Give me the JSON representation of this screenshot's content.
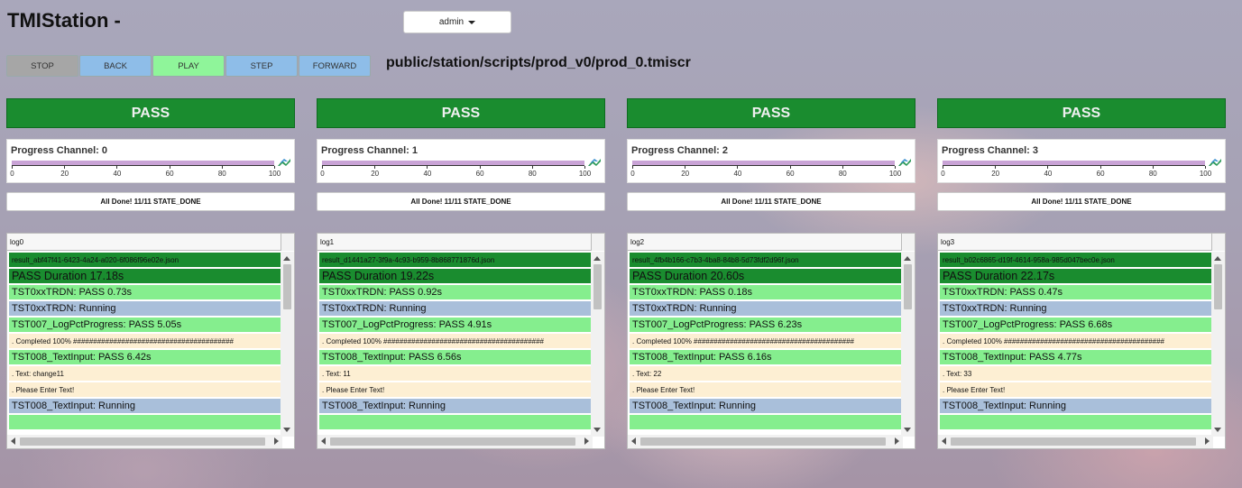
{
  "app": {
    "title": "TMIStation -"
  },
  "user_menu": {
    "label": "admin"
  },
  "controls": [
    {
      "label": "STOP",
      "color": "#a6a6a6"
    },
    {
      "label": "BACK",
      "color": "#8ebde8"
    },
    {
      "label": "PLAY",
      "color": "#8ff59a"
    },
    {
      "label": "STEP",
      "color": "#8ebde8"
    },
    {
      "label": "FORWARD",
      "color": "#8ebde8"
    }
  ],
  "script_path": "public/station/scripts/prod_v0/prod_0.tmiscr",
  "progress_ticks": [
    "0",
    "20",
    "40",
    "60",
    "80",
    "100"
  ],
  "channels": [
    {
      "status": "PASS",
      "progress_label": "Progress Channel: 0",
      "progress_percent": 100,
      "state_text": "All Done! 11/11 STATE_DONE",
      "log_title": "log0",
      "log_lines": [
        {
          "type": "file",
          "text": "result_abf47f41-6423-4a24-a020-6f086f96e02e.json"
        },
        {
          "type": "duration",
          "text": "PASS Duration 17.18s"
        },
        {
          "type": "pass",
          "text": "TST0xxTRDN: PASS 0.73s"
        },
        {
          "type": "running",
          "text": "TST0xxTRDN: Running"
        },
        {
          "type": "pass",
          "text": "TST007_LogPctProgress: PASS 5.05s"
        },
        {
          "type": "info",
          "text": ". Completed 100% ########################################"
        },
        {
          "type": "pass",
          "text": "TST008_TextInput: PASS 6.42s"
        },
        {
          "type": "info",
          "text": ". Text: change11"
        },
        {
          "type": "info",
          "text": ". Please Enter Text!"
        },
        {
          "type": "running",
          "text": "TST008_TextInput: Running"
        },
        {
          "type": "pass",
          "text": ""
        }
      ]
    },
    {
      "status": "PASS",
      "progress_label": "Progress Channel: 1",
      "progress_percent": 100,
      "state_text": "All Done! 11/11 STATE_DONE",
      "log_title": "log1",
      "log_lines": [
        {
          "type": "file",
          "text": "result_d1441a27-3f9a-4c93-b959-8b868771876d.json"
        },
        {
          "type": "duration",
          "text": "PASS Duration 19.22s"
        },
        {
          "type": "pass",
          "text": "TST0xxTRDN: PASS 0.92s"
        },
        {
          "type": "running",
          "text": "TST0xxTRDN: Running"
        },
        {
          "type": "pass",
          "text": "TST007_LogPctProgress: PASS 4.91s"
        },
        {
          "type": "info",
          "text": ". Completed 100% ########################################"
        },
        {
          "type": "pass",
          "text": "TST008_TextInput: PASS 6.56s"
        },
        {
          "type": "info",
          "text": ". Text: 11"
        },
        {
          "type": "info",
          "text": ". Please Enter Text!"
        },
        {
          "type": "running",
          "text": "TST008_TextInput: Running"
        },
        {
          "type": "pass",
          "text": ""
        }
      ]
    },
    {
      "status": "PASS",
      "progress_label": "Progress Channel: 2",
      "progress_percent": 100,
      "state_text": "All Done! 11/11 STATE_DONE",
      "log_title": "log2",
      "log_lines": [
        {
          "type": "file",
          "text": "result_4fb4b166-c7b3-4ba8-84b8-5d73fdf2d96f.json"
        },
        {
          "type": "duration",
          "text": "PASS Duration 20.60s"
        },
        {
          "type": "pass",
          "text": "TST0xxTRDN: PASS 0.18s"
        },
        {
          "type": "running",
          "text": "TST0xxTRDN: Running"
        },
        {
          "type": "pass",
          "text": "TST007_LogPctProgress: PASS 6.23s"
        },
        {
          "type": "info",
          "text": ". Completed 100% ########################################"
        },
        {
          "type": "pass",
          "text": "TST008_TextInput: PASS 6.16s"
        },
        {
          "type": "info",
          "text": ". Text: 22"
        },
        {
          "type": "info",
          "text": ". Please Enter Text!"
        },
        {
          "type": "running",
          "text": "TST008_TextInput: Running"
        },
        {
          "type": "pass",
          "text": ""
        }
      ]
    },
    {
      "status": "PASS",
      "progress_label": "Progress Channel: 3",
      "progress_percent": 100,
      "state_text": "All Done! 11/11 STATE_DONE",
      "log_title": "log3",
      "log_lines": [
        {
          "type": "file",
          "text": "result_b02c6865-d19f-4614-958a-985d047bec0e.json"
        },
        {
          "type": "duration",
          "text": "PASS Duration 22.17s"
        },
        {
          "type": "pass",
          "text": "TST0xxTRDN: PASS 0.47s"
        },
        {
          "type": "running",
          "text": "TST0xxTRDN: Running"
        },
        {
          "type": "pass",
          "text": "TST007_LogPctProgress: PASS 6.68s"
        },
        {
          "type": "info",
          "text": ". Completed 100% ########################################"
        },
        {
          "type": "pass",
          "text": "TST008_TextInput: PASS 4.77s"
        },
        {
          "type": "info",
          "text": ". Text: 33"
        },
        {
          "type": "info",
          "text": ". Please Enter Text!"
        },
        {
          "type": "running",
          "text": "TST008_TextInput: Running"
        },
        {
          "type": "pass",
          "text": ""
        }
      ]
    }
  ]
}
